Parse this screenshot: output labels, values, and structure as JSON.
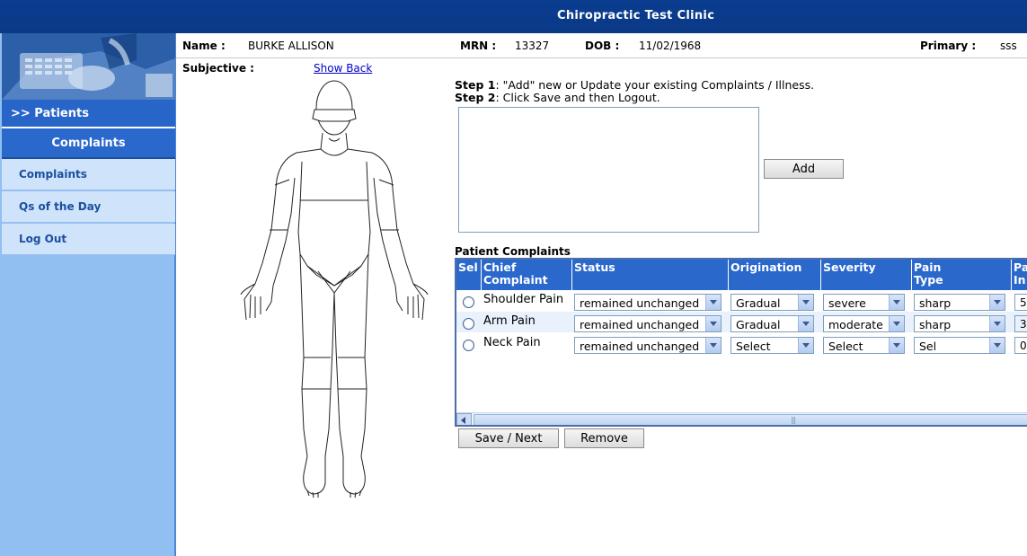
{
  "header": {
    "clinic_title": "Chiropractic Test Clinic"
  },
  "sidebar": {
    "patients_label": ">> Patients",
    "section_header": "Complaints",
    "items": [
      {
        "label": "Complaints"
      },
      {
        "label": "Qs of the Day"
      },
      {
        "label": "Log Out"
      }
    ]
  },
  "patient": {
    "name_label": "Name :",
    "name": "BURKE ALLISON",
    "mrn_label": "MRN :",
    "mrn": "13327",
    "dob_label": "DOB :",
    "dob": "11/02/1968",
    "primary_label": "Primary :",
    "primary": "sss"
  },
  "subjective": {
    "label": "Subjective :",
    "show_back_link": "Show Back"
  },
  "steps": {
    "step1_label": "Step 1",
    "step1_text": ": \"Add\" new or Update your existing Complaints / Illness.",
    "step2_label": "Step 2",
    "step2_text": ": Click Save and then Logout."
  },
  "complaint_input": {
    "value": ""
  },
  "buttons": {
    "add": "Add",
    "save_next": "Save / Next",
    "remove": "Remove"
  },
  "complaints_table": {
    "title": "Patient Complaints",
    "columns": {
      "sel": "Sel",
      "chief_1": "Chief",
      "chief_2": "Complaint",
      "status": "Status",
      "origination": "Origination",
      "severity": "Severity",
      "pain_1": "Pain",
      "pain_2": "Type",
      "next_1": "Pa",
      "next_2": "In"
    },
    "rows": [
      {
        "complaint": "Shoulder Pain",
        "status": "remained unchanged",
        "origination": "Gradual",
        "severity": "severe",
        "pain_type": "sharp",
        "next": "5"
      },
      {
        "complaint": "Arm Pain",
        "status": "remained unchanged",
        "origination": "Gradual",
        "severity": "moderate",
        "pain_type": "sharp",
        "next": "3"
      },
      {
        "complaint": "Neck Pain",
        "status": "remained unchanged",
        "origination": "Select",
        "severity": "Select",
        "pain_type": "Sel",
        "next": "0"
      }
    ]
  }
}
